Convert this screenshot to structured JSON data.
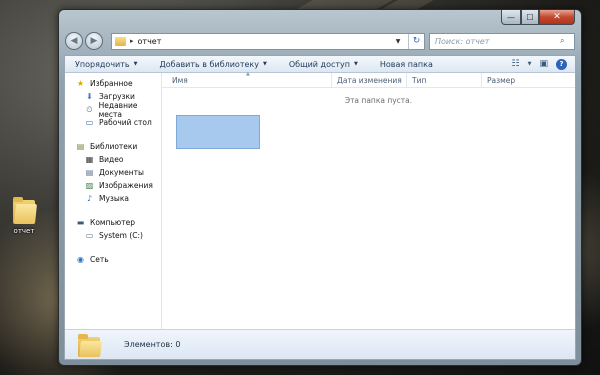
{
  "desktop": {
    "icon_label": "отчет"
  },
  "window": {
    "caption": {
      "minimize_icon": "minimize-icon",
      "maximize_icon": "maximize-icon",
      "close_icon": "close-icon",
      "min_glyph": "—",
      "max_glyph": "☐",
      "close_glyph": "✕"
    },
    "nav": {
      "back_glyph": "◀",
      "forward_glyph": "▶"
    },
    "address": {
      "chevron": "▸",
      "path": "отчет",
      "dropdown": "▼",
      "refresh_glyph": "↻"
    },
    "search": {
      "placeholder": "Поиск: отчет",
      "icon_glyph": "⌕"
    },
    "toolbar": {
      "items": [
        {
          "label": "Упорядочить",
          "caret": "▼"
        },
        {
          "label": "Добавить в библиотеку",
          "caret": "▼"
        },
        {
          "label": "Общий доступ",
          "caret": "▼"
        },
        {
          "label": "Новая папка"
        }
      ],
      "view_glyph": "☷",
      "view_caret": "▼",
      "preview_glyph": "▣",
      "help_glyph": "?"
    },
    "sidebar": {
      "favorites": {
        "label": "Избранное",
        "icon": "★",
        "items": [
          {
            "label": "Загрузки",
            "icon": "⬇"
          },
          {
            "label": "Недавние места",
            "icon": "⏲"
          },
          {
            "label": "Рабочий стол",
            "icon": "▭"
          }
        ]
      },
      "libraries": {
        "label": "Библиотеки",
        "icon": "▤",
        "items": [
          {
            "label": "Видео",
            "icon": "▦"
          },
          {
            "label": "Документы",
            "icon": "▤"
          },
          {
            "label": "Изображения",
            "icon": "▨"
          },
          {
            "label": "Музыка",
            "icon": "♪"
          }
        ]
      },
      "computer": {
        "label": "Компьютер",
        "icon": "▬",
        "items": [
          {
            "label": "System (C:)",
            "icon": "▭"
          }
        ]
      },
      "network": {
        "label": "Сеть",
        "icon": "◉"
      }
    },
    "columns": {
      "sort_caret": "▲",
      "name": "Имя",
      "date": "Дата изменения",
      "type": "Тип",
      "size": "Размер"
    },
    "empty_message": "Эта папка пуста.",
    "details": {
      "count_label": "Элементов: 0"
    },
    "colors": {
      "accent": "#2d63b8",
      "selection": "#a8c9ee"
    }
  }
}
